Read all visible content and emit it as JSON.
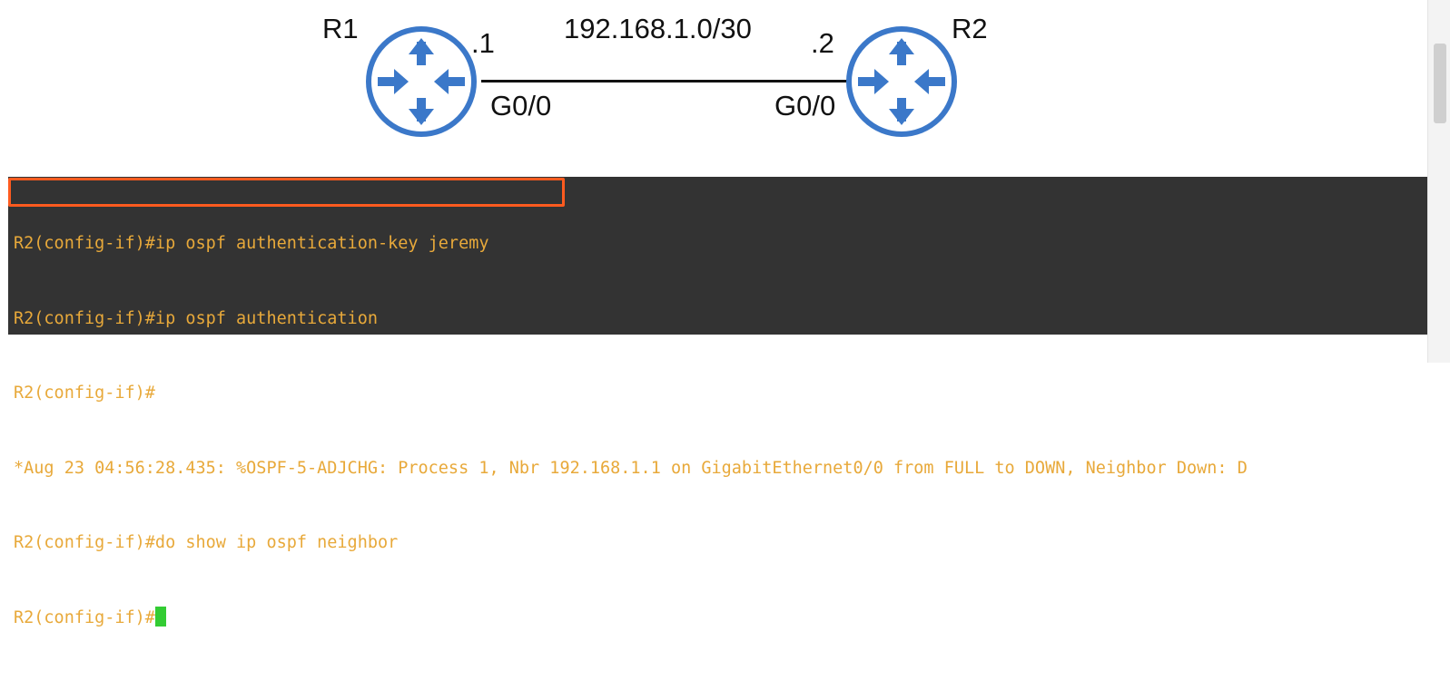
{
  "diagram": {
    "network": "192.168.1.0/30",
    "routers": [
      {
        "name": "R1",
        "ip_suffix": ".1",
        "interface": "G0/0"
      },
      {
        "name": "R2",
        "ip_suffix": ".2",
        "interface": "G0/0"
      }
    ],
    "colors": {
      "router": "#3b78c9",
      "link": "#111111"
    }
  },
  "terminal": {
    "lines": [
      "R2(config-if)#ip ospf authentication-key jeremy",
      "R2(config-if)#ip ospf authentication",
      "R2(config-if)#",
      "*Aug 23 04:56:28.435: %OSPF-5-ADJCHG: Process 1, Nbr 192.168.1.1 on GigabitEthernet0/0 from FULL to DOWN, Neighbor Down: D",
      "R2(config-if)#do show ip ospf neighbor",
      "R2(config-if)#"
    ],
    "highlighted_line": 0,
    "colors": {
      "background": "#333333",
      "text": "#e8a93a",
      "highlight": "#ff5b1f",
      "cursor": "#33cc33"
    }
  }
}
